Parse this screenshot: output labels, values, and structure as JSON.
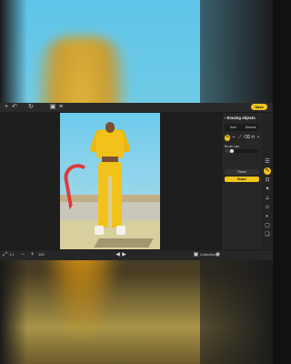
{
  "topbar": {
    "icons": [
      "plus-icon",
      "undo-icon",
      "redo-icon",
      "compare-icon",
      "menu-icon"
    ],
    "save_label": "Save"
  },
  "panel": {
    "title": "Erasing objects",
    "mode_options": [
      "Auto",
      "Manual"
    ],
    "brush_label": "Brush size",
    "brush_size_fraction": 0.18,
    "reset_label": "Reset",
    "erase_label": "Erase"
  },
  "bottombar": {
    "zoom_value": "1:1",
    "zoom_percent": "100",
    "collection_label": "Collection"
  },
  "colors": {
    "accent": "#f2c51c",
    "window_bg": "#232323",
    "panel_bg": "#262626"
  }
}
